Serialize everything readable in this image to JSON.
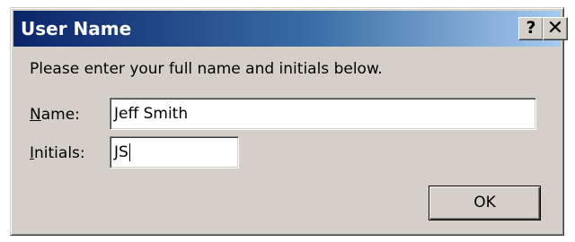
{
  "window": {
    "title": "User Name",
    "help_button": "?",
    "close_button": "✕"
  },
  "dialog": {
    "instruction": "Please enter your full name and initials below.",
    "name_label_accel": "N",
    "name_label_rest": "ame:",
    "name_value": "Jeff Smith",
    "initials_label_accel": "I",
    "initials_label_rest": "nitials:",
    "initials_value": "JS",
    "ok_label": "OK"
  },
  "colors": {
    "title_gradient_start": "#0a246a",
    "title_gradient_end": "#a6caf0",
    "face": "#d4d0c8"
  }
}
